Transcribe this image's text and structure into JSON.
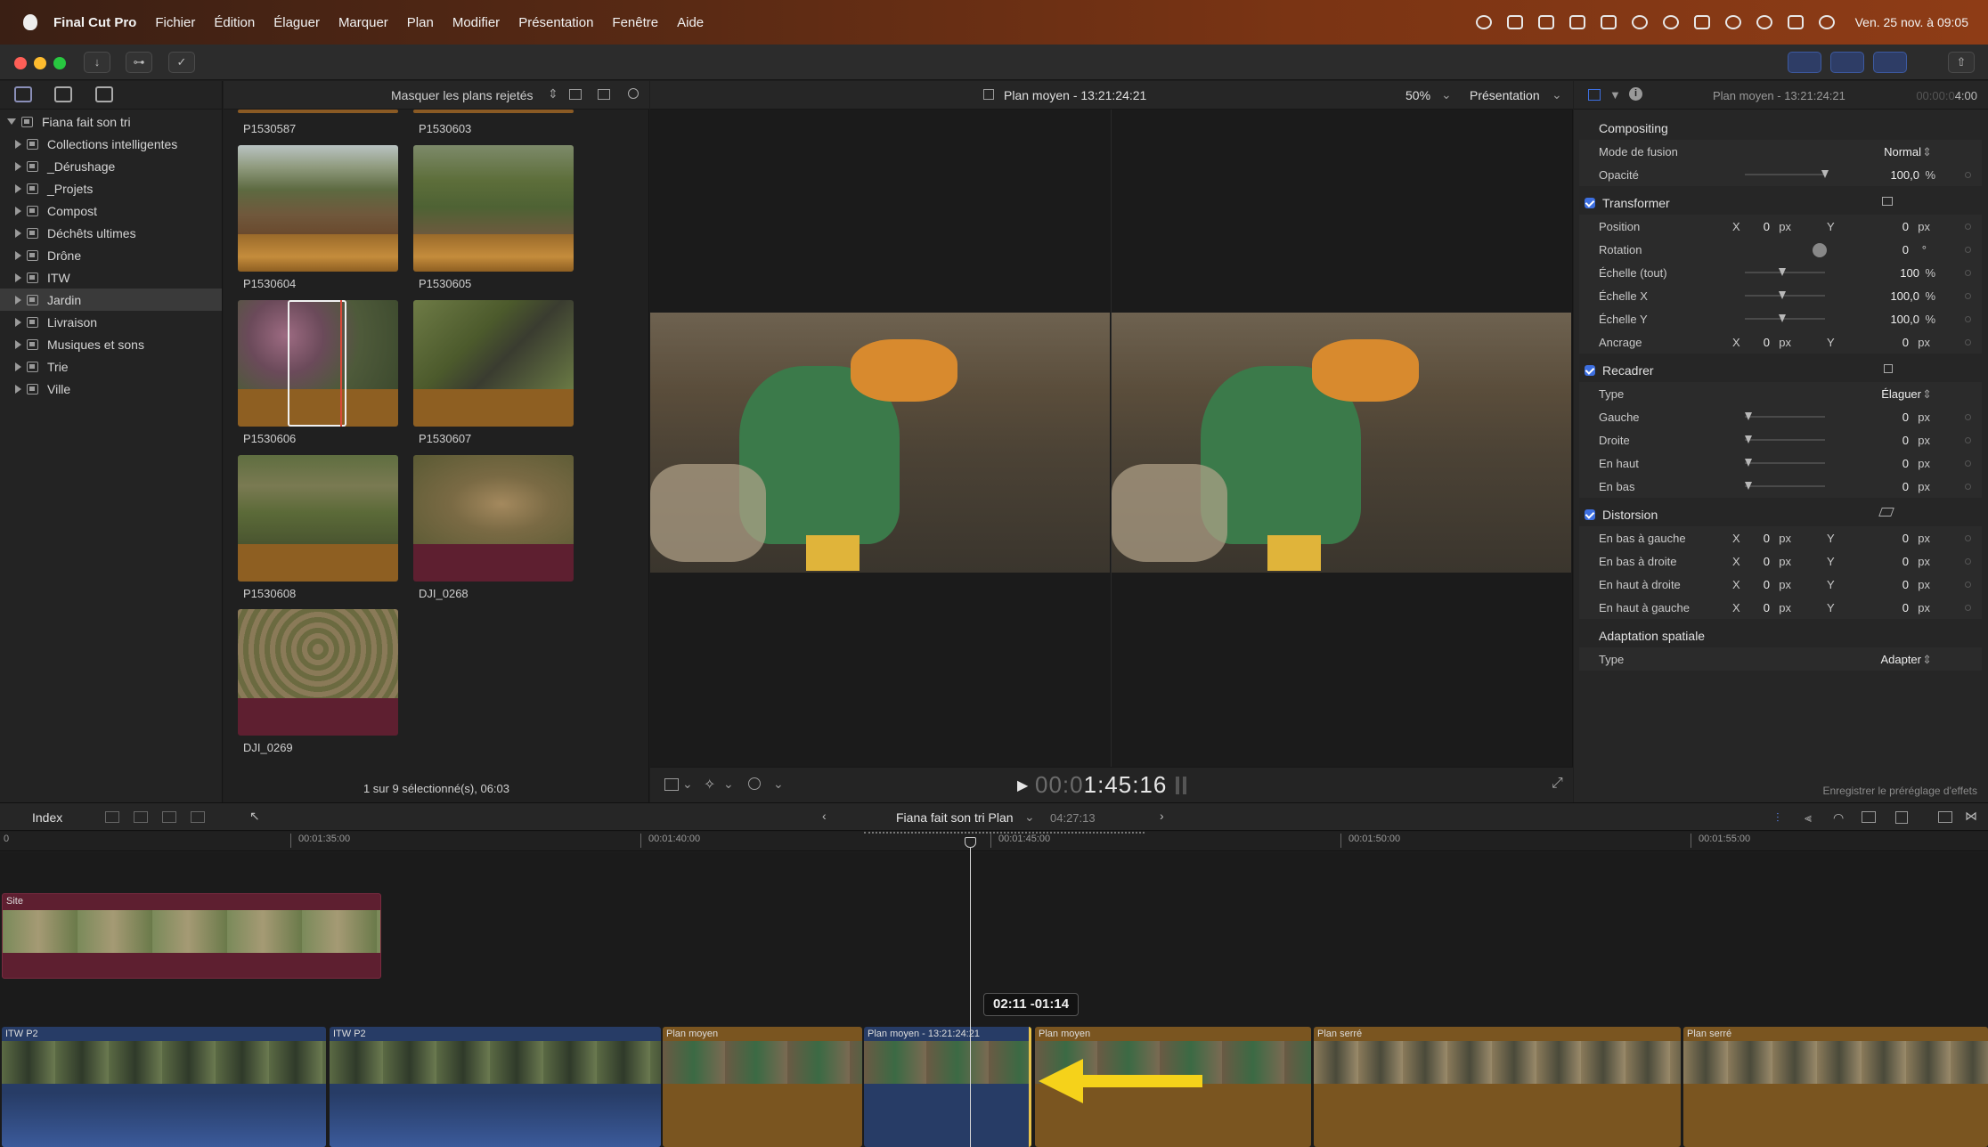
{
  "menubar": {
    "app_name": "Final Cut Pro",
    "items": [
      "Fichier",
      "Édition",
      "Élaguer",
      "Marquer",
      "Plan",
      "Modifier",
      "Présentation",
      "Fenêtre",
      "Aide"
    ],
    "clock": "Ven. 25 nov. à 09:05"
  },
  "library": {
    "root": "Fiana fait son tri",
    "events": [
      {
        "label": "Collections intelligentes",
        "icon": "folder-icon"
      },
      {
        "label": "_Dérushage",
        "icon": "event-icon"
      },
      {
        "label": "_Projets",
        "icon": "event-icon"
      },
      {
        "label": "Compost",
        "icon": "event-icon"
      },
      {
        "label": "Déchêts ultimes",
        "icon": "event-icon"
      },
      {
        "label": "Drône",
        "icon": "event-icon"
      },
      {
        "label": "ITW",
        "icon": "event-icon"
      },
      {
        "label": "Jardin",
        "icon": "event-icon",
        "selected": true
      },
      {
        "label": "Livraison",
        "icon": "event-icon"
      },
      {
        "label": "Musiques et sons",
        "icon": "event-icon"
      },
      {
        "label": "Trie",
        "icon": "event-icon"
      },
      {
        "label": "Ville",
        "icon": "event-icon"
      }
    ]
  },
  "browser": {
    "filter": "Masquer les plans rejetés",
    "clips": [
      "P1530587",
      "P1530603",
      "P1530604",
      "P1530605",
      "P1530606",
      "P1530607",
      "P1530608",
      "DJI_0268",
      "DJI_0269"
    ],
    "footer": "1 sur 9 sélectionné(s), 06:03"
  },
  "viewer": {
    "title": "Plan moyen - 13:21:24:21",
    "zoom": "50%",
    "view_menu": "Présentation",
    "timecode_dim": "00:0",
    "timecode": "1:45:16"
  },
  "inspector": {
    "clip_name": "Plan moyen - 13:21:24:21",
    "duration_dim": "00:00:0",
    "duration": "4:00",
    "compositing": {
      "title": "Compositing",
      "blend_label": "Mode de fusion",
      "blend_value": "Normal",
      "opacity_label": "Opacité",
      "opacity_value": "100,0",
      "opacity_unit": "%"
    },
    "transform": {
      "title": "Transformer",
      "position_label": "Position",
      "rotation_label": "Rotation",
      "rotation_value": "0",
      "rotation_unit": "°",
      "scale_all_label": "Échelle (tout)",
      "scale_all_value": "100",
      "scale_x_label": "Échelle X",
      "scale_x_value": "100,0",
      "scale_y_label": "Échelle Y",
      "scale_y_value": "100,0",
      "anchor_label": "Ancrage"
    },
    "crop": {
      "title": "Recadrer",
      "type_label": "Type",
      "type_value": "Élaguer",
      "left_label": "Gauche",
      "right_label": "Droite",
      "top_label": "En haut",
      "bottom_label": "En bas"
    },
    "distort": {
      "title": "Distorsion",
      "bl_label": "En bas à gauche",
      "br_label": "En bas à droite",
      "tr_label": "En haut à droite",
      "tl_label": "En haut à gauche"
    },
    "spatial": {
      "title": "Adaptation spatiale",
      "type_label": "Type",
      "type_value": "Adapter"
    },
    "zero": "0",
    "px": "px",
    "pct": "%",
    "x": "X",
    "y": "Y",
    "save_preset": "Enregistrer le préréglage d'effets"
  },
  "timeline": {
    "index_label": "Index",
    "project": "Fiana fait son tri Plan",
    "duration": "04:27:13",
    "ruler": [
      "0",
      "00:01:35:00",
      "00:01:40:00",
      "00:01:45:00",
      "00:01:50:00",
      "00:01:55:00"
    ],
    "connected_clip": "Site",
    "clips": [
      "ITW P2",
      "ITW P2",
      "Plan moyen",
      "Plan moyen - 13:21:24:21",
      "Plan moyen",
      "Plan serré",
      "Plan serré"
    ],
    "trim_readout": "02:11 -01:14"
  },
  "colors": {
    "accent": "#3d6fe0",
    "clip_orange": "#7a5520",
    "clip_blue": "#273c66",
    "connected": "#5e1f30",
    "arrow": "#f5d21a"
  }
}
